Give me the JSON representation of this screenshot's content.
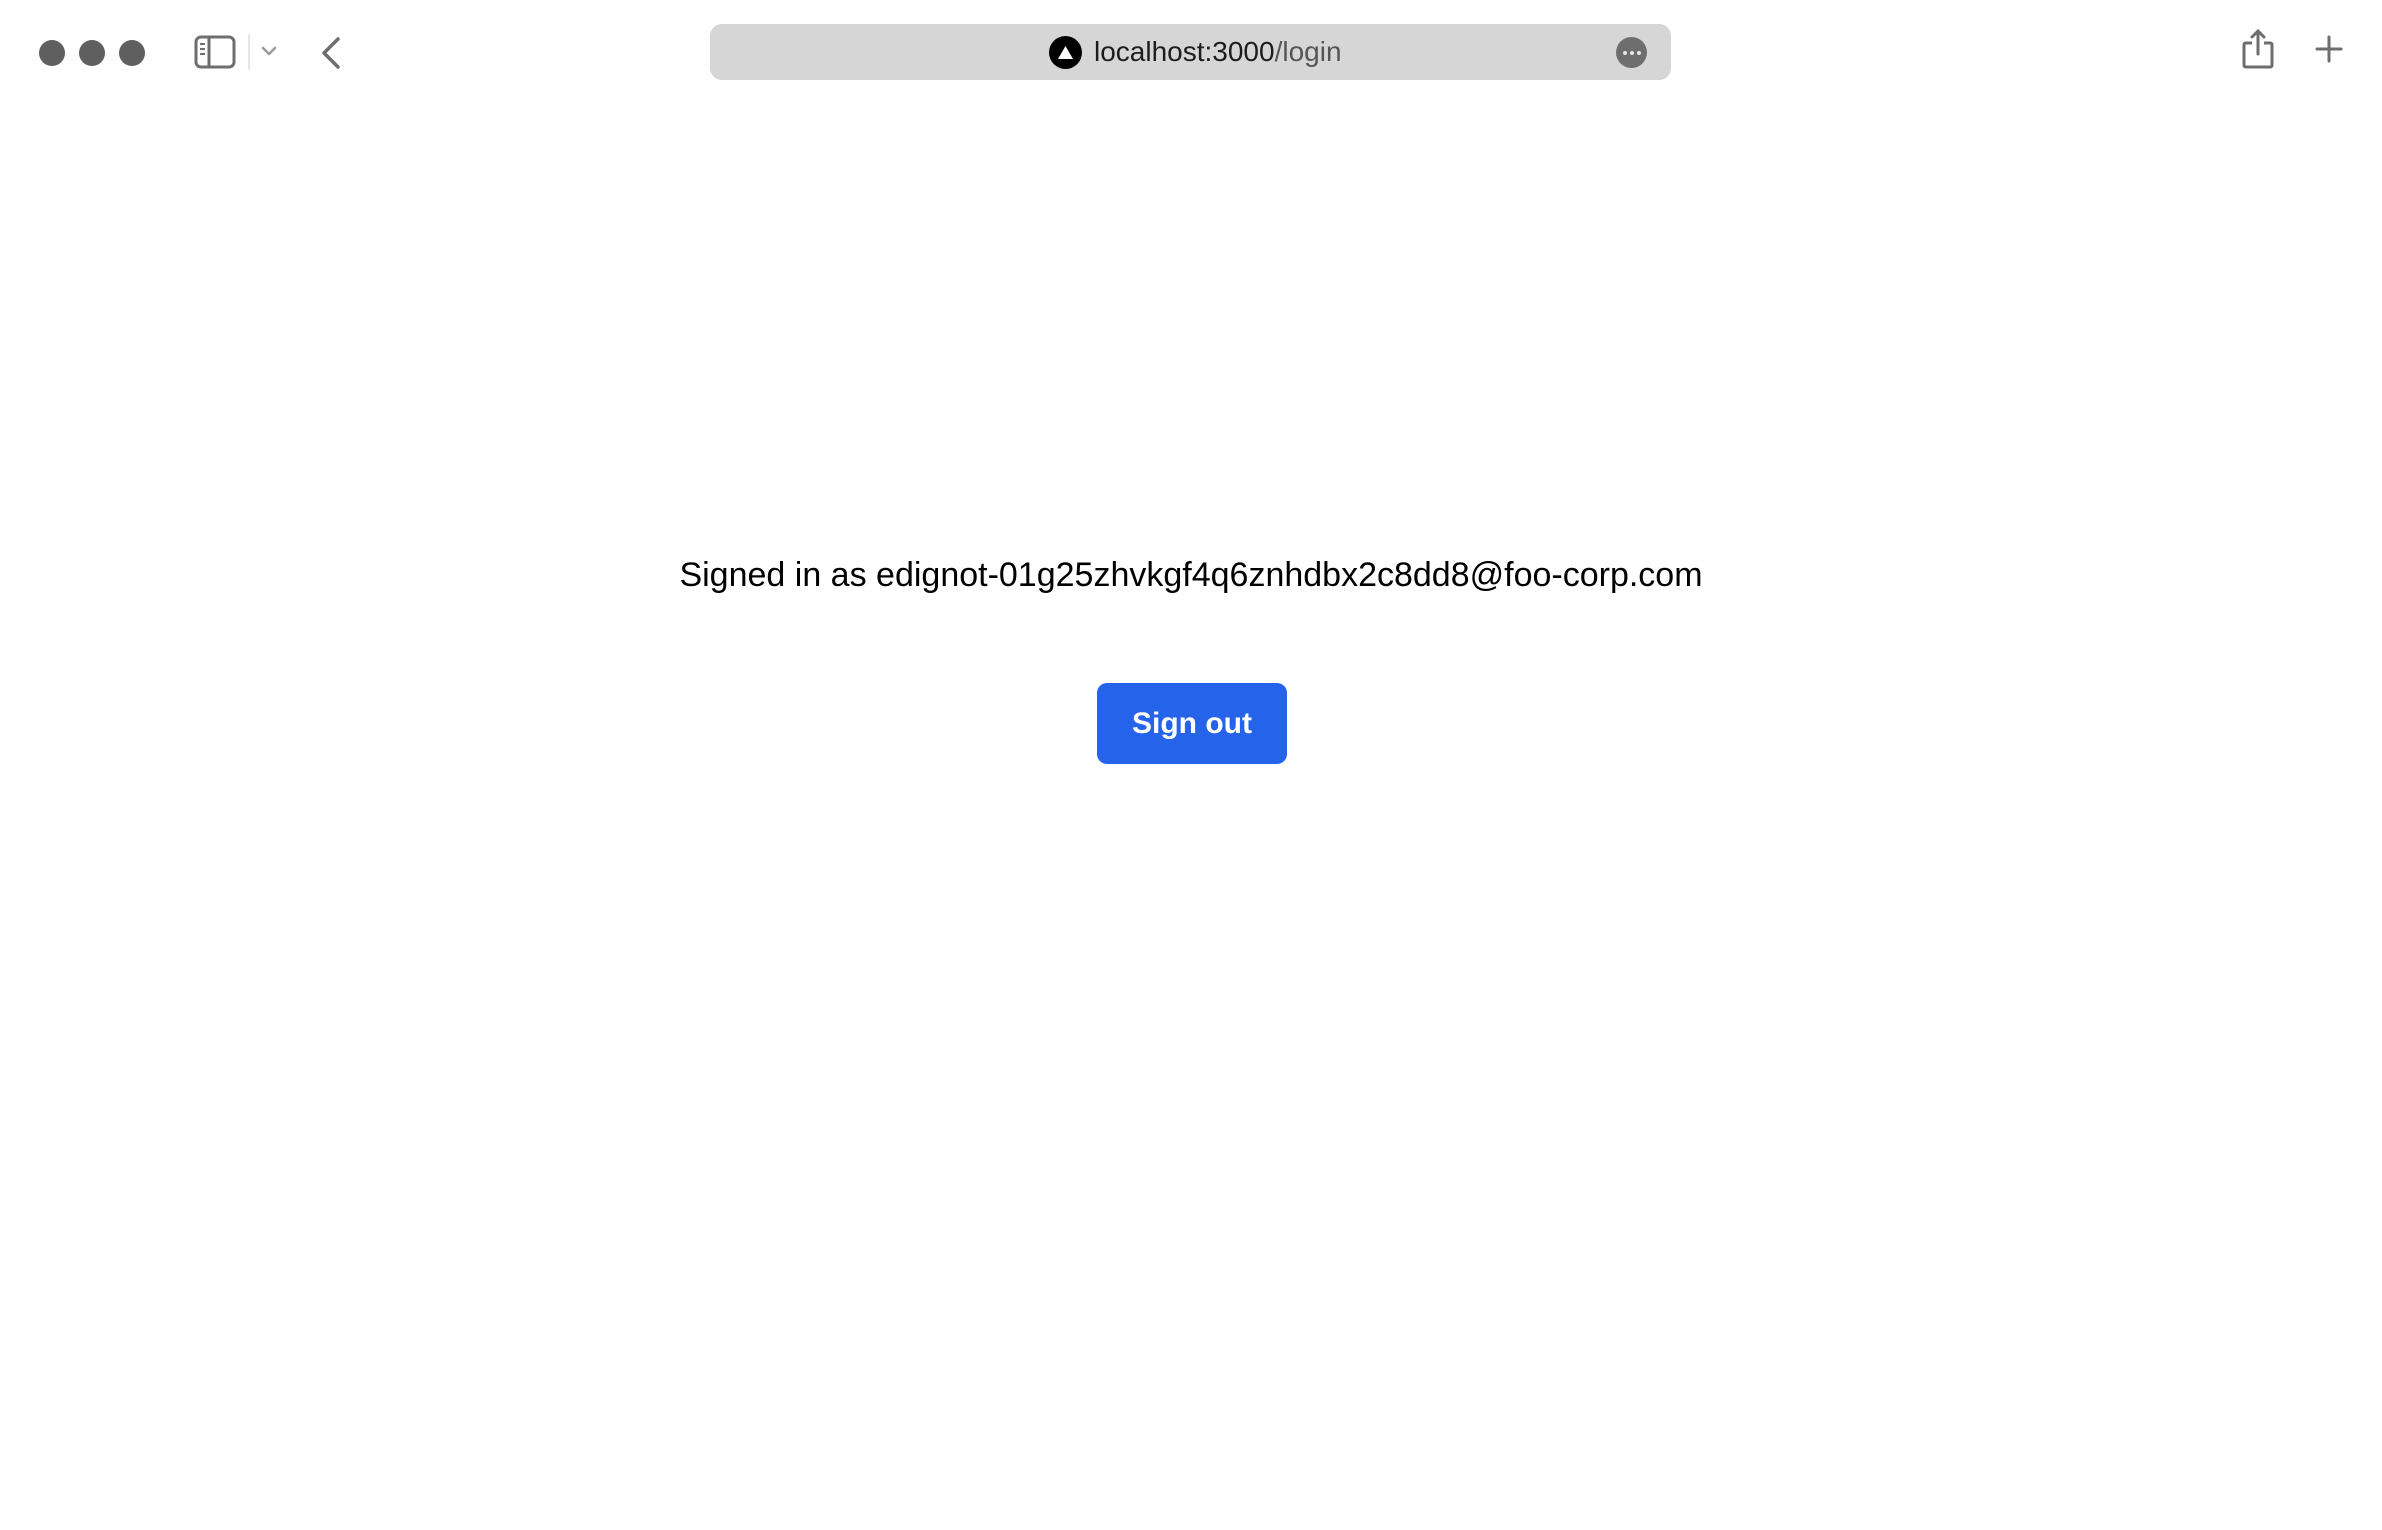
{
  "browser": {
    "window_controls": [
      {
        "name": "close",
        "icon": "traffic-light-close"
      },
      {
        "name": "minimize",
        "icon": "traffic-light-minimize"
      },
      {
        "name": "maximize",
        "icon": "traffic-light-maximize"
      }
    ],
    "toolbar": {
      "sidebar_icon": "sidebar-icon",
      "tab_menu_icon": "chevron-down-icon",
      "back_icon": "chevron-left-icon",
      "share_icon": "share-icon",
      "new_tab_icon": "plus-icon"
    },
    "address_bar": {
      "site_icon": "triangle-logo-icon",
      "host": "localhost:3000",
      "path": "/login",
      "more_icon": "ellipsis-icon"
    }
  },
  "page": {
    "signed_in_text": "Signed in as edignot-01g25zhvkgf4q6znhdbx2c8dd8@foo-corp.com",
    "sign_out_label": "Sign out",
    "colors": {
      "button_bg": "#2563eb",
      "button_text": "#ffffff",
      "address_bar_bg": "#d6d6d6"
    }
  }
}
